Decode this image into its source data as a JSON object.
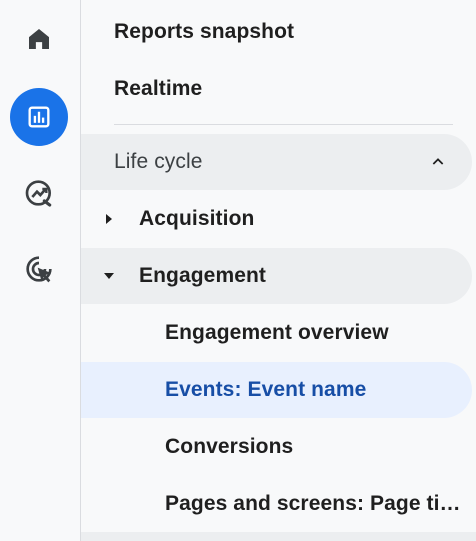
{
  "rail": {
    "items": [
      {
        "icon": "home-icon",
        "active": false
      },
      {
        "icon": "reports-icon",
        "active": true
      },
      {
        "icon": "explore-icon",
        "active": false
      },
      {
        "icon": "advertising-icon",
        "active": false
      }
    ],
    "accent": "#1a73e8"
  },
  "nav": {
    "reports_snapshot": "Reports snapshot",
    "realtime": "Realtime",
    "section": {
      "label": "Life cycle",
      "expanded": true
    },
    "groups": [
      {
        "label": "Acquisition",
        "expanded": false
      },
      {
        "label": "Engagement",
        "expanded": true
      }
    ],
    "engagement_items": [
      {
        "label": "Engagement overview",
        "selected": false
      },
      {
        "label": "Events: Event name",
        "selected": true
      },
      {
        "label": "Conversions",
        "selected": false
      },
      {
        "label": "Pages and screens: Page ti…",
        "selected": false
      }
    ],
    "selected_color": "#174ea6",
    "selected_bg": "#e8f0fe"
  }
}
